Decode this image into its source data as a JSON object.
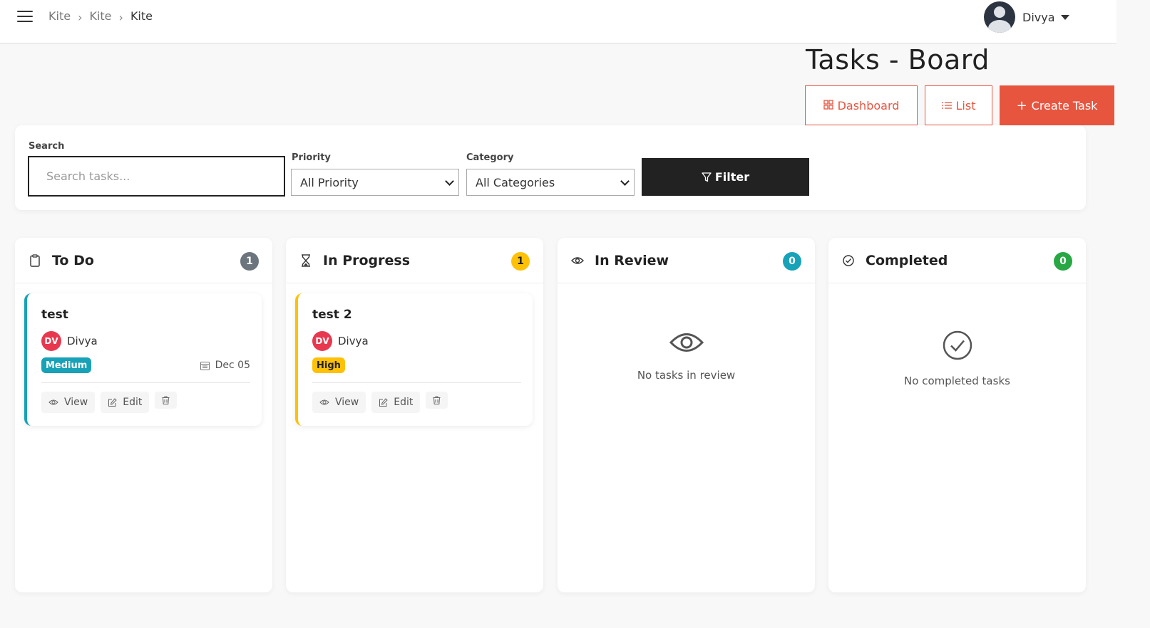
{
  "breadcrumb": [
    "Kite",
    "Kite",
    "Kite"
  ],
  "user": {
    "name": "Divya"
  },
  "page": {
    "title": "Tasks - Board"
  },
  "actions": {
    "dashboard": "Dashboard",
    "list": "List",
    "create": "Create Task"
  },
  "filters": {
    "search_label": "Search",
    "search_placeholder": "Search tasks...",
    "search_value": "",
    "priority_label": "Priority",
    "priority_value": "All Priority",
    "category_label": "Category",
    "category_value": "All Categories",
    "filter_button": "Filter"
  },
  "columns": [
    {
      "title": "To Do",
      "count": "1",
      "icon": "clipboard-icon",
      "badge_color": "#6c757d",
      "tasks": [
        {
          "title": "test",
          "assignee_initials": "DV",
          "assignee": "Divya",
          "priority": "Medium",
          "priority_color": "#17a2b8",
          "priority_text_color": "#ffffff",
          "due": "Dec 05",
          "accent": "#17a2b8",
          "view": "View",
          "edit": "Edit"
        }
      ]
    },
    {
      "title": "In Progress",
      "count": "1",
      "icon": "hourglass-icon",
      "badge_color": "#ffc107",
      "tasks": [
        {
          "title": "test 2",
          "assignee_initials": "DV",
          "assignee": "Divya",
          "priority": "High",
          "priority_color": "#ffc107",
          "priority_text_color": "#222222",
          "accent": "#ffc107",
          "view": "View",
          "edit": "Edit"
        }
      ]
    },
    {
      "title": "In Review",
      "count": "0",
      "icon": "eye-icon",
      "badge_color": "#17a2b8",
      "empty_text": "No tasks in review"
    },
    {
      "title": "Completed",
      "count": "0",
      "icon": "check-circle-icon",
      "badge_color": "#28a745",
      "empty_text": "No completed tasks"
    }
  ]
}
